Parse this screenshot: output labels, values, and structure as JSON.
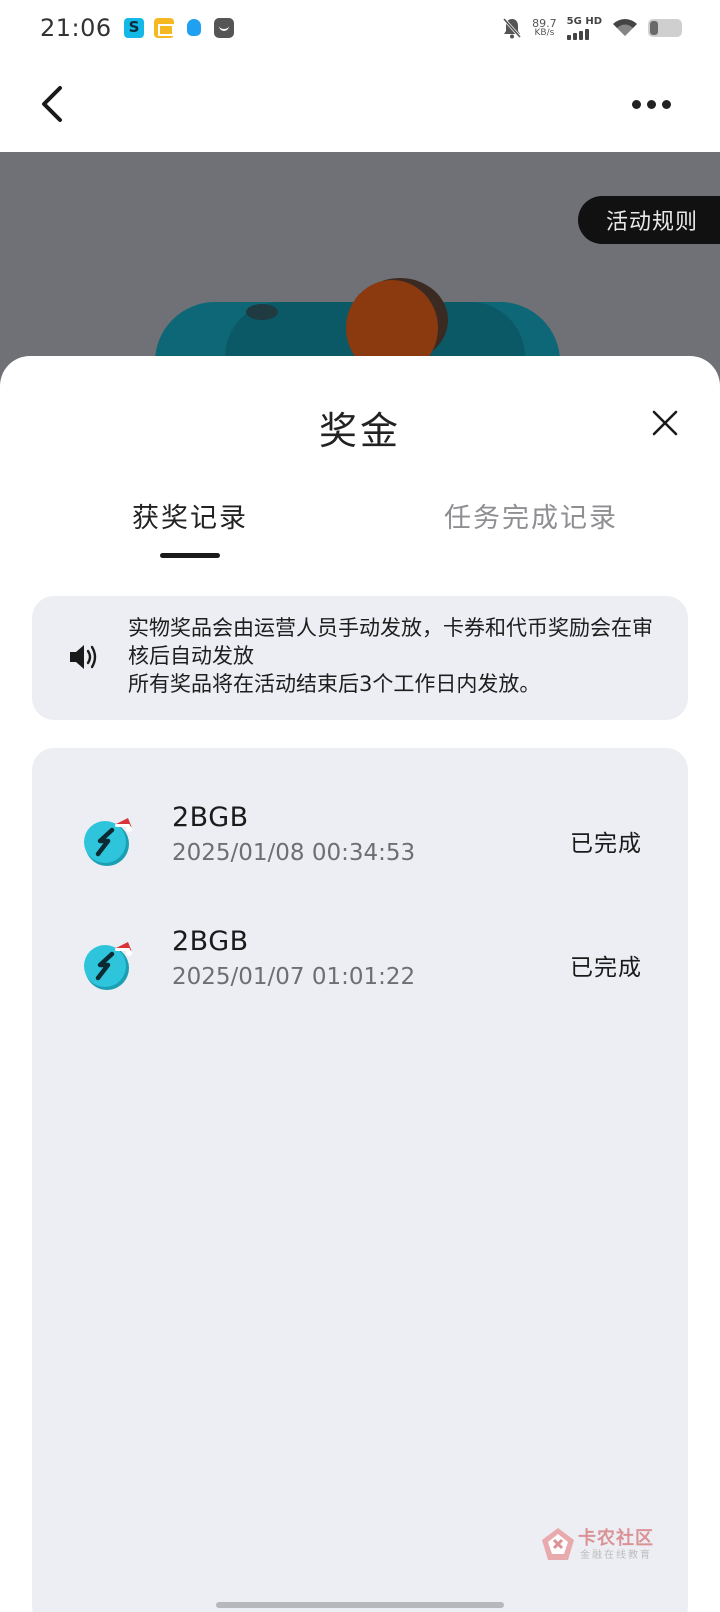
{
  "status_bar": {
    "time": "21:06",
    "net_speed_value": "89.7",
    "net_speed_unit": "KB/s",
    "signal_label": "5G HD",
    "icons": [
      "app-s-icon",
      "mail-app-icon",
      "qq-icon",
      "shop-app-icon",
      "bell-mute-icon",
      "wifi-icon",
      "battery-icon"
    ]
  },
  "nav": {
    "back_icon": "chevron-left-icon",
    "more_icon": "more-dots-icon"
  },
  "banner": {
    "rules_label": "活动规则"
  },
  "sheet": {
    "title": "奖金",
    "close_icon": "close-icon",
    "tabs": [
      {
        "label": "获奖记录",
        "active": true
      },
      {
        "label": "任务完成记录",
        "active": false
      }
    ],
    "notice": {
      "icon": "speaker-icon",
      "lines": [
        "实物奖品会由运营人员手动发放，卡券和代币奖励会在审核后自动发放",
        "所有奖品将在活动结束后3个工作日内发放。"
      ]
    },
    "records": [
      {
        "name": "2BGB",
        "time": "2025/01/08 00:34:53",
        "status": "已完成"
      },
      {
        "name": "2BGB",
        "time": "2025/01/07 01:01:22",
        "status": "已完成"
      }
    ]
  },
  "watermark": {
    "name": "卡农社区",
    "sub": "金融在线教育"
  },
  "colors": {
    "banner_bg": "#6f7176",
    "panel_bg": "#eceef3",
    "coin_cyan": "#2ec5dc",
    "deco_teal": "#0e6e7c",
    "deco_orange": "#8a3a0e"
  }
}
